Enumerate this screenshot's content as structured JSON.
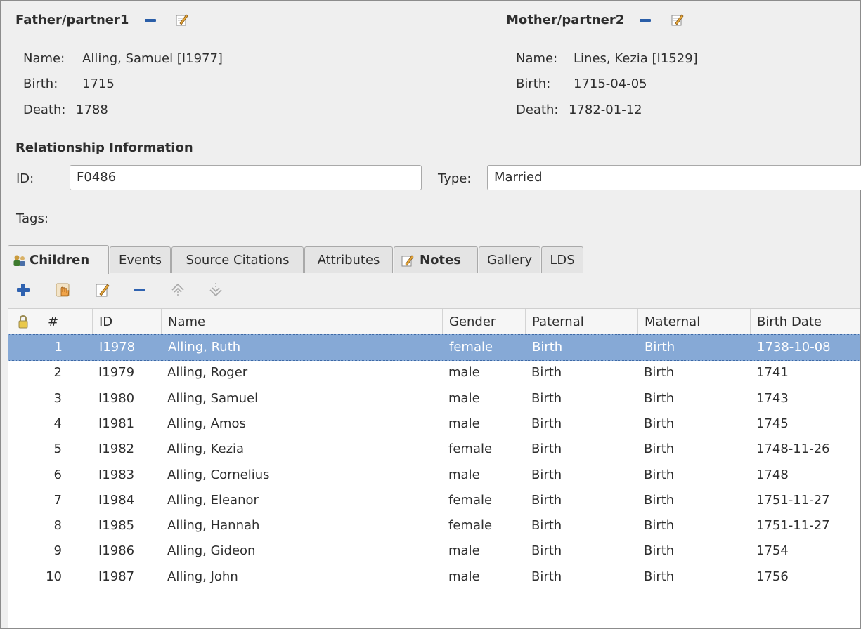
{
  "father": {
    "title": "Father/partner1",
    "name_label": "Name:",
    "name_value": "Alling, Samuel [I1977]",
    "birth_label": "Birth:",
    "birth_value": "1715",
    "death_label": "Death:",
    "death_value": "1788"
  },
  "mother": {
    "title": "Mother/partner2",
    "name_label": "Name:",
    "name_value": "Lines, Kezia [I1529]",
    "birth_label": "Birth:",
    "birth_value": "1715-04-05",
    "death_label": "Death:",
    "death_value": "1782-01-12"
  },
  "relationship": {
    "title": "Relationship Information",
    "id_label": "ID:",
    "id_value": "F0486",
    "type_label": "Type:",
    "type_value": "Married",
    "tags_label": "Tags:"
  },
  "tabs": [
    {
      "label": "Children",
      "icon": "children-icon",
      "active": true
    },
    {
      "label": "Events"
    },
    {
      "label": "Source Citations"
    },
    {
      "label": "Attributes"
    },
    {
      "label": "Notes",
      "icon": "notes-icon"
    },
    {
      "label": "Gallery"
    },
    {
      "label": "LDS"
    }
  ],
  "toolbar": [
    "add-icon",
    "share-icon",
    "edit-icon",
    "remove-icon",
    "move-up-icon",
    "move-down-icon"
  ],
  "table": {
    "columns": [
      "#",
      "ID",
      "Name",
      "Gender",
      "Paternal",
      "Maternal",
      "Birth Date"
    ],
    "rows": [
      {
        "num": "1",
        "id": "I1978",
        "name": "Alling, Ruth",
        "gender": "female",
        "paternal": "Birth",
        "maternal": "Birth",
        "birth": "1738-10-08"
      },
      {
        "num": "2",
        "id": "I1979",
        "name": "Alling, Roger",
        "gender": "male",
        "paternal": "Birth",
        "maternal": "Birth",
        "birth": "1741"
      },
      {
        "num": "3",
        "id": "I1980",
        "name": "Alling, Samuel",
        "gender": "male",
        "paternal": "Birth",
        "maternal": "Birth",
        "birth": "1743"
      },
      {
        "num": "4",
        "id": "I1981",
        "name": "Alling, Amos",
        "gender": "male",
        "paternal": "Birth",
        "maternal": "Birth",
        "birth": "1745"
      },
      {
        "num": "5",
        "id": "I1982",
        "name": "Alling, Kezia",
        "gender": "female",
        "paternal": "Birth",
        "maternal": "Birth",
        "birth": "1748-11-26"
      },
      {
        "num": "6",
        "id": "I1983",
        "name": "Alling, Cornelius",
        "gender": "male",
        "paternal": "Birth",
        "maternal": "Birth",
        "birth": "1748"
      },
      {
        "num": "7",
        "id": "I1984",
        "name": "Alling, Eleanor",
        "gender": "female",
        "paternal": "Birth",
        "maternal": "Birth",
        "birth": "1751-11-27"
      },
      {
        "num": "8",
        "id": "I1985",
        "name": "Alling, Hannah",
        "gender": "female",
        "paternal": "Birth",
        "maternal": "Birth",
        "birth": "1751-11-27"
      },
      {
        "num": "9",
        "id": "I1986",
        "name": "Alling, Gideon",
        "gender": "male",
        "paternal": "Birth",
        "maternal": "Birth",
        "birth": "1754"
      },
      {
        "num": "10",
        "id": "I1987",
        "name": "Alling, John",
        "gender": "male",
        "paternal": "Birth",
        "maternal": "Birth",
        "birth": "1756"
      }
    ],
    "selected_row": 0
  },
  "colors": {
    "selection": "#86a9d6",
    "accent_blue": "#2a5ea8"
  }
}
